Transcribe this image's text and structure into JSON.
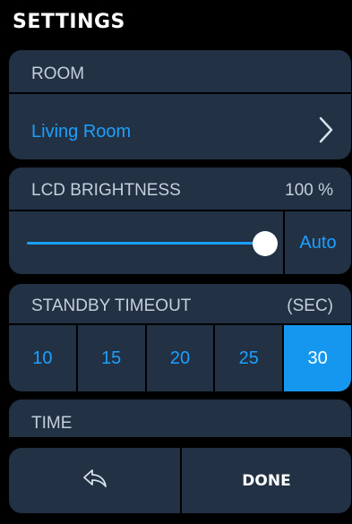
{
  "header": {
    "title": "SETTINGS"
  },
  "room": {
    "label": "ROOM",
    "value": "Living Room",
    "icon": "chevron-right-icon"
  },
  "brightness": {
    "label": "LCD BRIGHTNESS",
    "value_text": "100 %",
    "level": 1.0,
    "auto_label": "Auto"
  },
  "standby": {
    "label": "STANDBY TIMEOUT",
    "unit": "(SEC)",
    "options": [
      "10",
      "15",
      "20",
      "25",
      "30"
    ],
    "selected": "30"
  },
  "time": {
    "label": "TIME"
  },
  "footer": {
    "back_icon": "back-arrow-icon",
    "done_label": "DONE"
  },
  "colors": {
    "accent": "#1ca0ff",
    "panel": "#223144",
    "background": "#000000",
    "selected": "#1597f0"
  }
}
